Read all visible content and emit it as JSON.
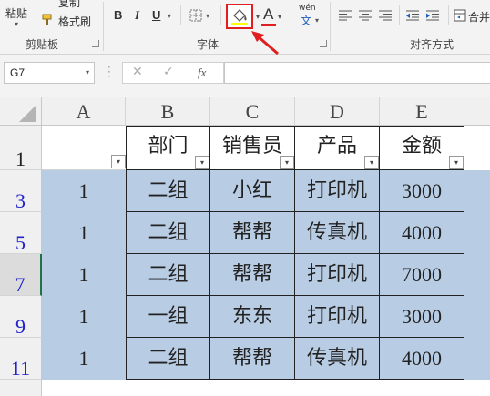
{
  "ribbon": {
    "clipboard": {
      "paste_label": "粘贴",
      "copy_label": "复制",
      "format_painter_label": "格式刷",
      "group_label": "剪贴板"
    },
    "font": {
      "bold_label": "B",
      "italic_label": "I",
      "underline_label": "U",
      "font_color_label": "A",
      "font_color_hex": "#e02020",
      "phonetic_label": "wén",
      "phonetic_char": "文",
      "group_label": "字体"
    },
    "alignment": {
      "merge_label": "合并",
      "group_label": "对齐方式"
    },
    "highlight_color": "#e02020"
  },
  "formula_bar": {
    "name_box_value": "G7",
    "cancel_icon": "cancel-icon",
    "enter_icon": "enter-icon",
    "fx_label": "fx",
    "formula_value": ""
  },
  "grid": {
    "columns": [
      "A",
      "B",
      "C",
      "D",
      "E"
    ],
    "header_row_number": "1",
    "table_headers": [
      "部门",
      "销售员",
      "产品",
      "金额"
    ],
    "rows": [
      {
        "row_number": "3",
        "a": "1",
        "dept": "二组",
        "salesperson": "小红",
        "product": "打印机",
        "amount": "3000"
      },
      {
        "row_number": "5",
        "a": "1",
        "dept": "二组",
        "salesperson": "帮帮",
        "product": "传真机",
        "amount": "4000"
      },
      {
        "row_number": "7",
        "a": "1",
        "dept": "二组",
        "salesperson": "帮帮",
        "product": "打印机",
        "amount": "7000"
      },
      {
        "row_number": "9",
        "a": "1",
        "dept": "一组",
        "salesperson": "东东",
        "product": "打印机",
        "amount": "3000"
      },
      {
        "row_number": "11",
        "a": "1",
        "dept": "二组",
        "salesperson": "帮帮",
        "product": "传真机",
        "amount": "4000"
      }
    ],
    "band_color": "#b8cce4",
    "row_number_color": "#2222cc"
  }
}
